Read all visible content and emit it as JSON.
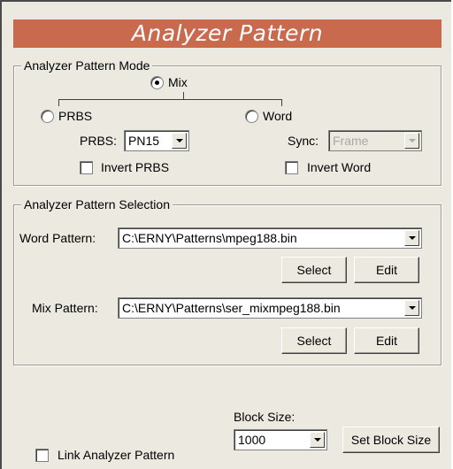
{
  "title": "Analyzer Pattern",
  "mode_group": {
    "legend": "Analyzer Pattern Mode",
    "mix_label": "Mix",
    "prbs_label": "PRBS",
    "word_label": "Word",
    "selected_mode": "Mix",
    "prbs_field_label": "PRBS:",
    "prbs_value": "PN15",
    "sync_field_label": "Sync:",
    "sync_value": "Frame",
    "invert_prbs_label": "Invert PRBS",
    "invert_prbs_checked": false,
    "invert_word_label": "Invert Word",
    "invert_word_checked": false
  },
  "selection_group": {
    "legend": "Analyzer Pattern Selection",
    "word_pattern_label": "Word Pattern:",
    "word_pattern_value": "C:\\ERNY\\Patterns\\mpeg188.bin",
    "mix_pattern_label": "Mix Pattern:",
    "mix_pattern_value": "C:\\ERNY\\Patterns\\ser_mixmpeg188.bin",
    "select_label": "Select",
    "edit_label": "Edit"
  },
  "footer": {
    "link_label": "Link Analyzer Pattern",
    "link_checked": false,
    "block_size_label": "Block Size:",
    "block_size_value": "1000",
    "set_block_size_label": "Set Block Size"
  }
}
